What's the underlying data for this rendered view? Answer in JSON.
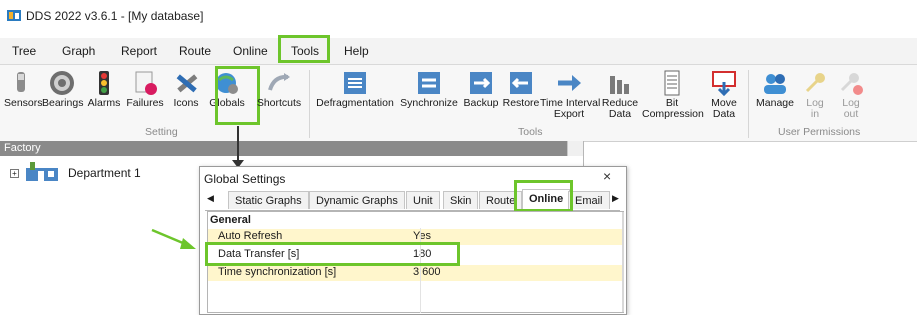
{
  "window": {
    "title": "DDS 2022 v3.6.1 - [My database]"
  },
  "menu": {
    "items": [
      "Tree",
      "Graph",
      "Report",
      "Route",
      "Online",
      "Tools",
      "Help"
    ],
    "active": "Tools"
  },
  "ribbon": {
    "setting_group": "Setting",
    "tools_group": "Tools",
    "user_group": "User Permissions",
    "buttons": {
      "sensors": "Sensors",
      "bearings": "Bearings",
      "alarms": "Alarms",
      "failures": "Failures",
      "icons": "Icons",
      "globals": "Globals",
      "shortcuts": "Shortcuts",
      "defragmentation": "Defragmentation",
      "synchronize": "Synchronize",
      "backup": "Backup",
      "restore": "Restore",
      "time_interval_export_l1": "Time Interval",
      "time_interval_export_l2": "Export",
      "reduce_data_l1": "Reduce",
      "reduce_data_l2": "Data",
      "bit_compression_l1": "Bit",
      "bit_compression_l2": "Compression",
      "move_data_l1": "Move",
      "move_data_l2": "Data",
      "manage": "Manage",
      "log_in_l1": "Log",
      "log_in_l2": "in",
      "log_out_l1": "Log",
      "log_out_l2": "out"
    }
  },
  "tree": {
    "header": "Factory",
    "node": "Department 1"
  },
  "dialog": {
    "title": "Global Settings",
    "close": "×",
    "tabs": [
      "Static Graphs",
      "Dynamic Graphs",
      "Unit",
      "Skin",
      "Route",
      "Online",
      "Email"
    ],
    "active_tab": "Online",
    "group": "General",
    "rows": [
      {
        "key": "Auto Refresh",
        "value": "Yes"
      },
      {
        "key": "Data Transfer [s]",
        "value": "180"
      },
      {
        "key": "Time synchronization [s]",
        "value": "3 600"
      }
    ]
  },
  "colors": {
    "highlight": "#6dc52b",
    "tree_header": "#8a8a8a",
    "row_yellow": "#fff6cc"
  }
}
